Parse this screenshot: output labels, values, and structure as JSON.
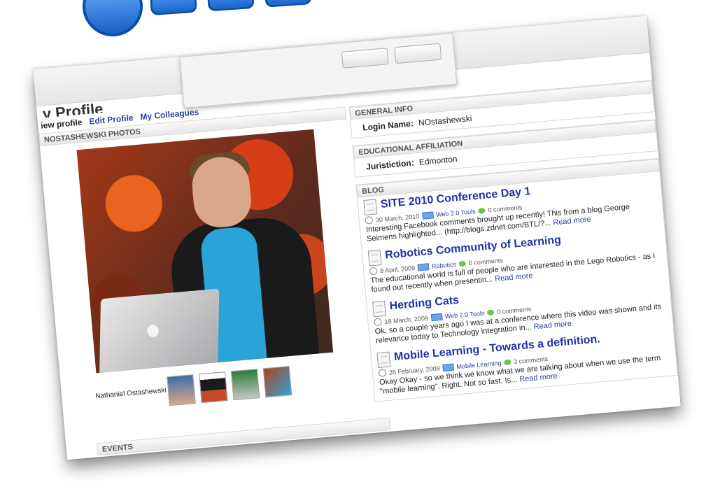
{
  "tabs": {
    "view_profile": "iew profile",
    "edit_profile": "Edit Profile",
    "my_colleagues": "My Colleagues"
  },
  "photos": {
    "header": "NOSTASHEWSKI PHOTOS",
    "caption": "Nathaniel Ostashewski"
  },
  "events": {
    "header": "EVENTS"
  },
  "general_info": {
    "header": "GENERAL INFO",
    "login_label": "Login Name:",
    "login_value": "NOstashewski"
  },
  "educational_affiliation": {
    "header": "EDUCATIONAL AFFILIATION",
    "jurisdiction_label": "Juristiction:",
    "jurisdiction_value": "Edmonton"
  },
  "blog": {
    "header": "BLOG",
    "read_more": "Read more",
    "posts": [
      {
        "title": "SITE 2010 Conference Day 1",
        "date": "30 March, 2010",
        "category": "Web 2.0 Tools",
        "comments": "0 comments",
        "excerpt": "Interesting Facebook comments brought up recently! This from a blog George Seimens highlighted... (http://blogs.zdnet.com/BTL/?..."
      },
      {
        "title": "Robotics Community of Learning",
        "date": "8 April, 2009",
        "category": "Robotics",
        "comments": "0 comments",
        "excerpt": "The educational world is full of people who are interested in the Lego Robotics - as I found out recently when presentin..."
      },
      {
        "title": "Herding Cats",
        "date": "18 March, 2009",
        "category": "Web 2.0 Tools",
        "comments": "0 comments",
        "excerpt": "Ok, so a couple years ago I was at a conference where this video was shown and its relevance today to Technology integration in..."
      },
      {
        "title": "Mobile Learning - Towards a definition.",
        "date": "26 February, 2009",
        "category": "Mobile Learning",
        "comments": "3 comments",
        "excerpt": "Okay Okay - so we think we know what we are talking about when we use the term \"mobile learning\". Right.  Not so fast. Is..."
      }
    ]
  },
  "colors": {
    "link": "#2a3fa3",
    "post_title": "#2231a8",
    "logo_blue": "#1e73d6"
  }
}
